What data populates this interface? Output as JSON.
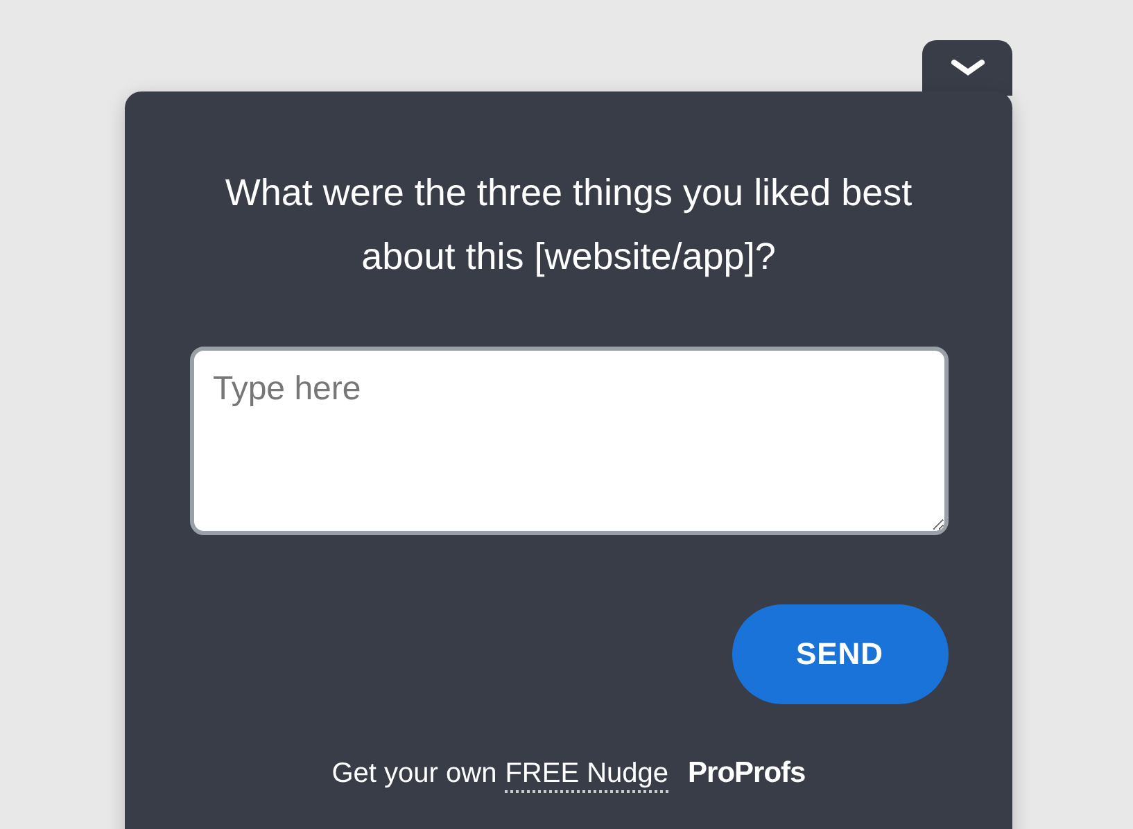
{
  "widget": {
    "question": "What were the three things you liked best about this [website/app]?",
    "answer": {
      "placeholder": "Type here"
    },
    "send_button": "SEND",
    "footer": {
      "text": "Get your own",
      "link": "FREE Nudge",
      "brand": "ProProfs"
    }
  }
}
